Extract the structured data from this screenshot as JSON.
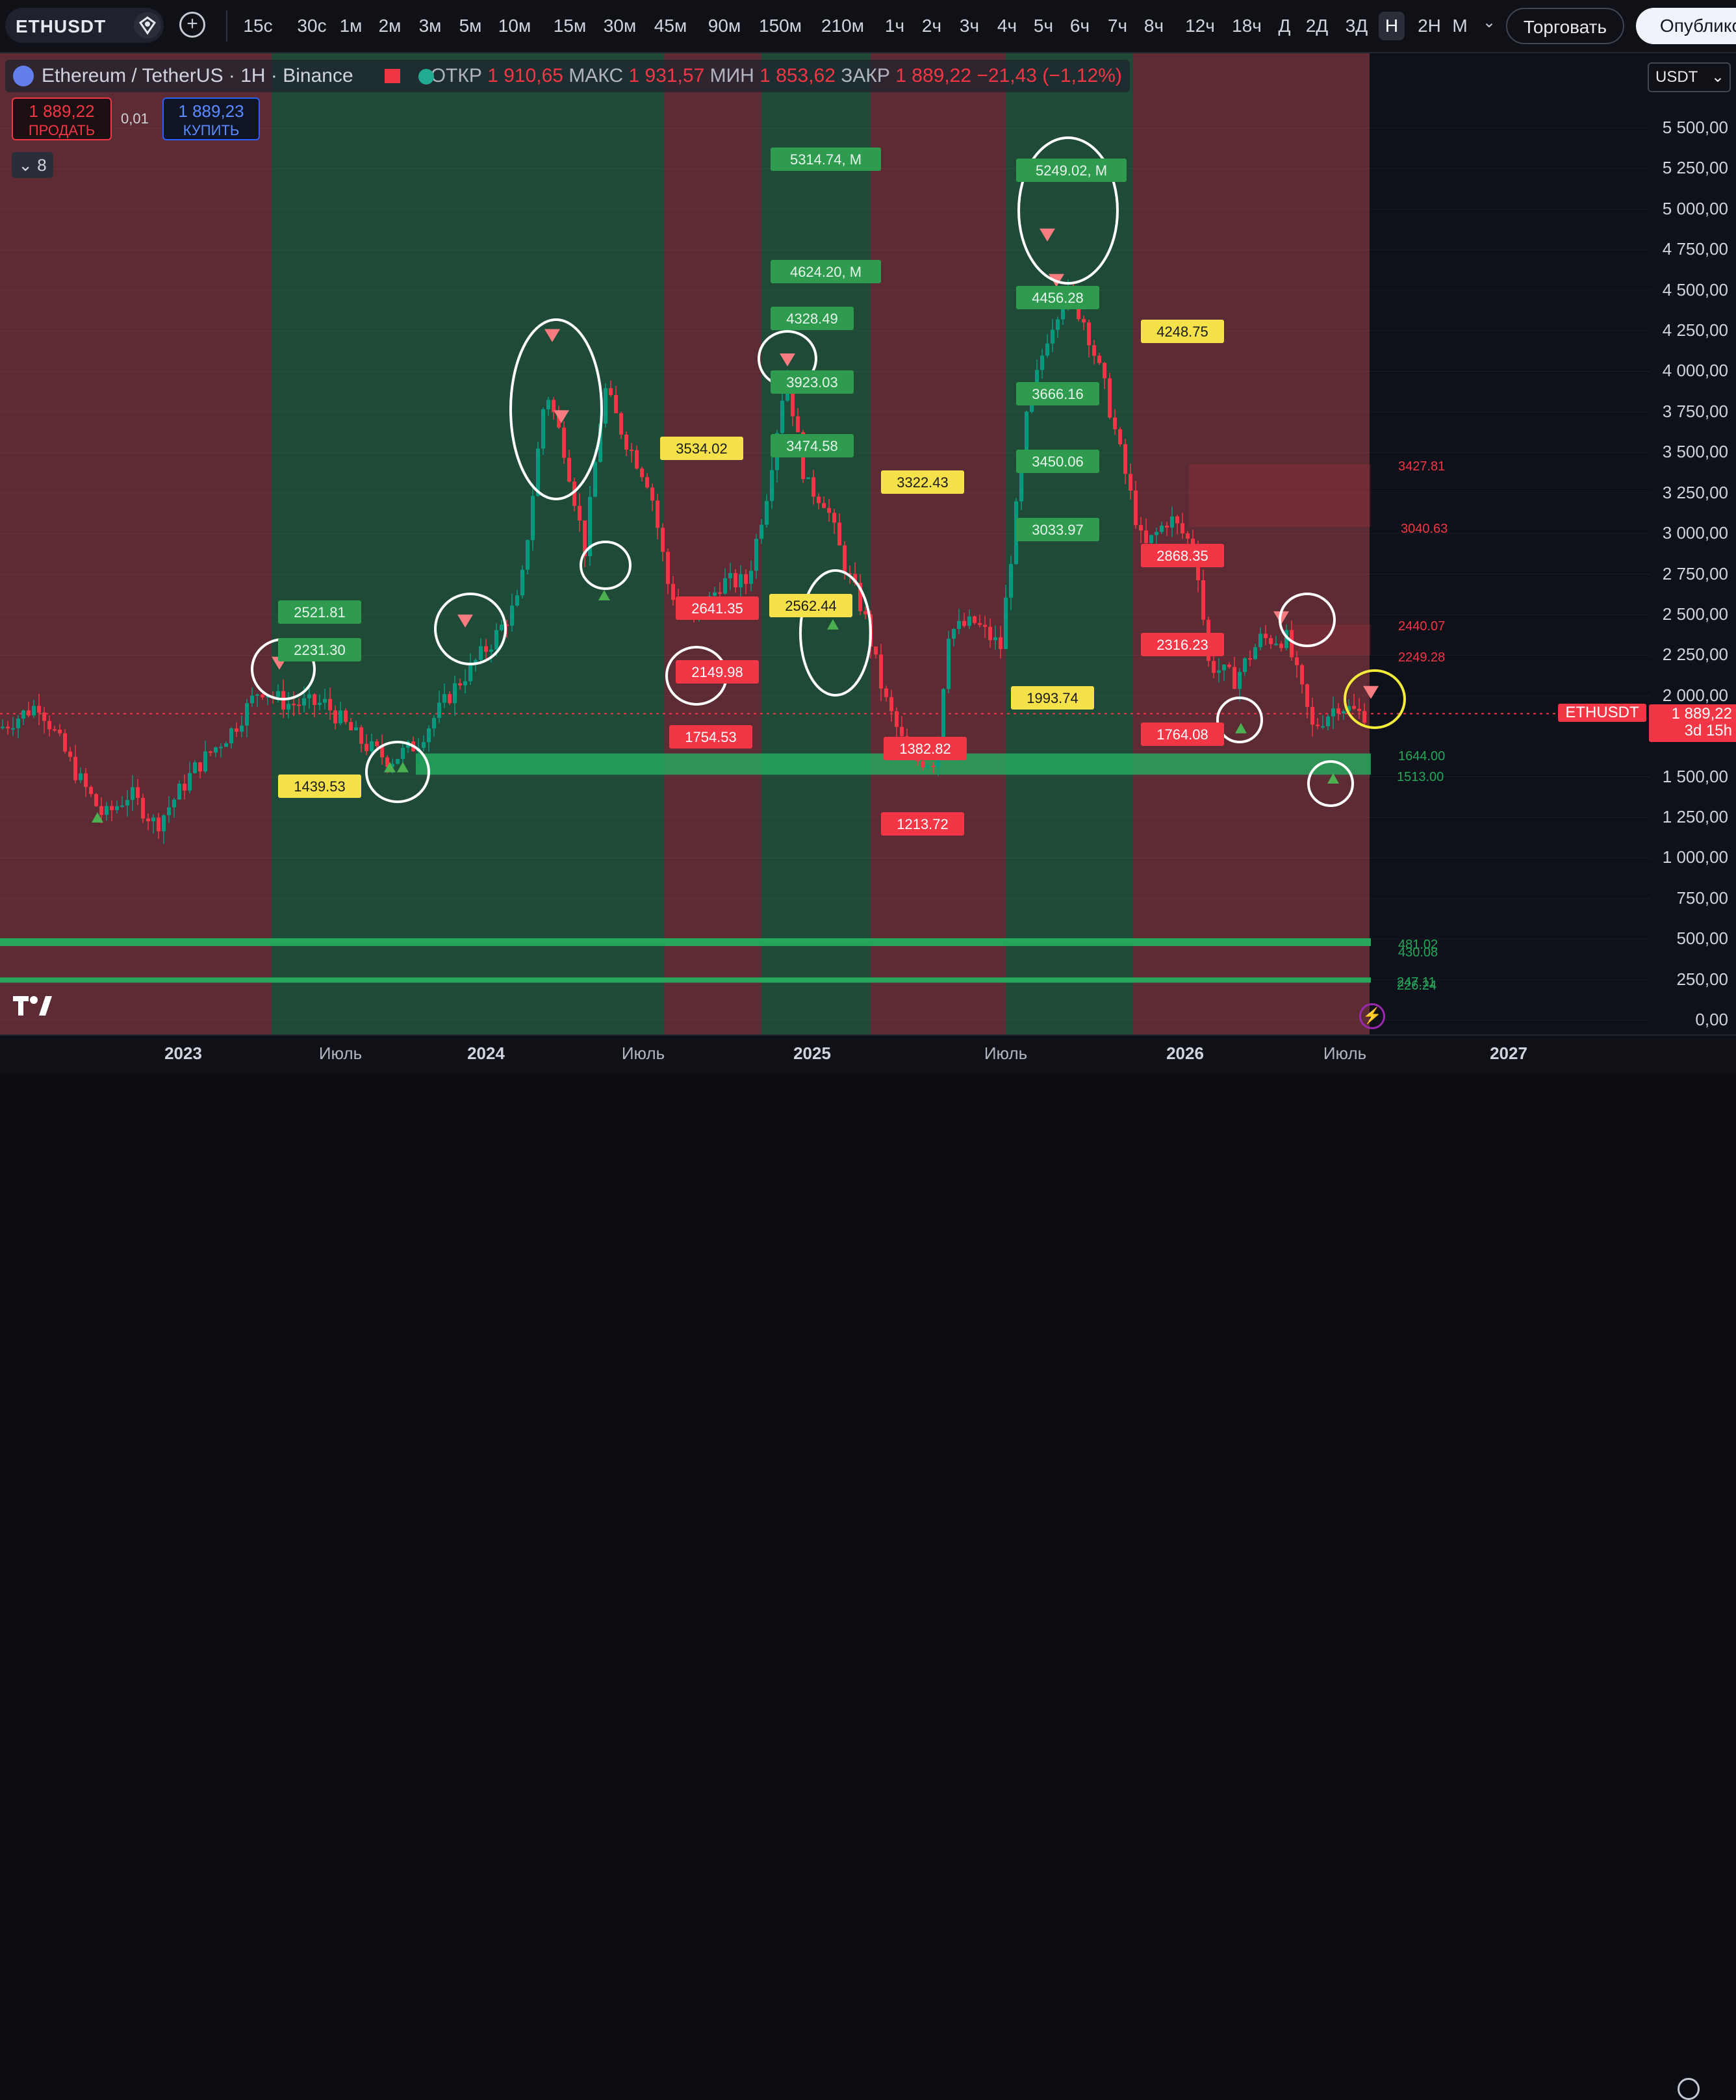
{
  "toolbar": {
    "symbol": "ETHUSDT",
    "timeframes": [
      {
        "label": "15с"
      },
      {
        "label": "30с"
      },
      {
        "label": "1м"
      },
      {
        "label": "2м"
      },
      {
        "label": "3м"
      },
      {
        "label": "5м"
      },
      {
        "label": "10м"
      },
      {
        "label": "15м"
      },
      {
        "label": "30м"
      },
      {
        "label": "45м"
      },
      {
        "label": "90м"
      },
      {
        "label": "150м"
      },
      {
        "label": "210м"
      },
      {
        "label": "1ч"
      },
      {
        "label": "2ч"
      },
      {
        "label": "3ч"
      },
      {
        "label": "4ч"
      },
      {
        "label": "5ч"
      },
      {
        "label": "6ч"
      },
      {
        "label": "7ч"
      },
      {
        "label": "8ч"
      },
      {
        "label": "12ч"
      },
      {
        "label": "18ч"
      },
      {
        "label": "Д"
      },
      {
        "label": "2Д"
      },
      {
        "label": "3Д"
      },
      {
        "label": "Н"
      },
      {
        "label": "2Н"
      },
      {
        "label": "М"
      }
    ],
    "active_timeframe": "Н",
    "trade_label": "Торговать",
    "publish_label": "Опублико"
  },
  "legend": {
    "title": "Ethereum / TetherUS · 1H · Binance",
    "open_label": "ОТКР",
    "open": "1 910,65",
    "high_label": "МАКС",
    "high": "1 931,57",
    "low_label": "МИН",
    "low": "1 853,62",
    "close_label": "ЗАКР",
    "close": "1 889,22",
    "change": "−21,43 (−1,12%)"
  },
  "order": {
    "sell_price": "1 889,22",
    "sell_label": "ПРОДАТЬ",
    "spread": "0,01",
    "buy_price": "1 889,23",
    "buy_label": "КУПИТЬ",
    "indicators_count": "8"
  },
  "currency": "USDT",
  "y_axis": [
    "5 500,00",
    "5 250,00",
    "5 000,00",
    "4 750,00",
    "4 500,00",
    "4 250,00",
    "4 000,00",
    "3 750,00",
    "3 500,00",
    "3 250,00",
    "3 000,00",
    "2 750,00",
    "2 500,00",
    "2 250,00",
    "2 000,00",
    "1 500,00",
    "1 250,00",
    "1 000,00",
    "750,00",
    "500,00",
    "250,00",
    "0,00"
  ],
  "x_axis": [
    {
      "label": "2023",
      "year": true
    },
    {
      "label": "Июль",
      "year": false
    },
    {
      "label": "2024",
      "year": true
    },
    {
      "label": "Июль",
      "year": false
    },
    {
      "label": "2025",
      "year": true
    },
    {
      "label": "Июль",
      "year": false
    },
    {
      "label": "2026",
      "year": true
    },
    {
      "label": "Июль",
      "year": false
    },
    {
      "label": "2027",
      "year": true
    }
  ],
  "current_price": {
    "symbol": "ETHUSDT",
    "price": "1 889,22",
    "countdown": "3d 15h"
  },
  "labels": [
    {
      "text": "2521.81",
      "color": "green"
    },
    {
      "text": "2231.30",
      "color": "green"
    },
    {
      "text": "1439.53",
      "color": "yellow"
    },
    {
      "text": "5314.74, M",
      "color": "green"
    },
    {
      "text": "4624.20, M",
      "color": "green"
    },
    {
      "text": "4328.49",
      "color": "green"
    },
    {
      "text": "3923.03",
      "color": "green"
    },
    {
      "text": "3474.58",
      "color": "green"
    },
    {
      "text": "3534.02",
      "color": "yellow"
    },
    {
      "text": "3322.43",
      "color": "yellow"
    },
    {
      "text": "2562.44",
      "color": "yellow"
    },
    {
      "text": "2641.35",
      "color": "red"
    },
    {
      "text": "2149.98",
      "color": "red"
    },
    {
      "text": "1754.53",
      "color": "red"
    },
    {
      "text": "1382.82",
      "color": "red"
    },
    {
      "text": "1213.72",
      "color": "red"
    },
    {
      "text": "5249.02, M",
      "color": "green"
    },
    {
      "text": "4456.28",
      "color": "green"
    },
    {
      "text": "3666.16",
      "color": "green"
    },
    {
      "text": "3450.06",
      "color": "green"
    },
    {
      "text": "3033.97",
      "color": "green"
    },
    {
      "text": "1993.74",
      "color": "yellow"
    },
    {
      "text": "4248.75",
      "color": "yellow"
    },
    {
      "text": "2868.35",
      "color": "red"
    },
    {
      "text": "2316.23",
      "color": "red"
    },
    {
      "text": "1764.08",
      "color": "red"
    }
  ],
  "zone_levels": [
    "3427.81",
    "3040.63",
    "2440.07",
    "2249.28",
    "1644.00",
    "1513.00",
    "481.02",
    "430.08",
    "247.11",
    "226.24"
  ],
  "colors": {
    "bear_zone": "#5c2b33",
    "bull_zone": "#1e4a37",
    "up": "#089981",
    "down": "#f23645",
    "accent_green": "#26a65b"
  }
}
